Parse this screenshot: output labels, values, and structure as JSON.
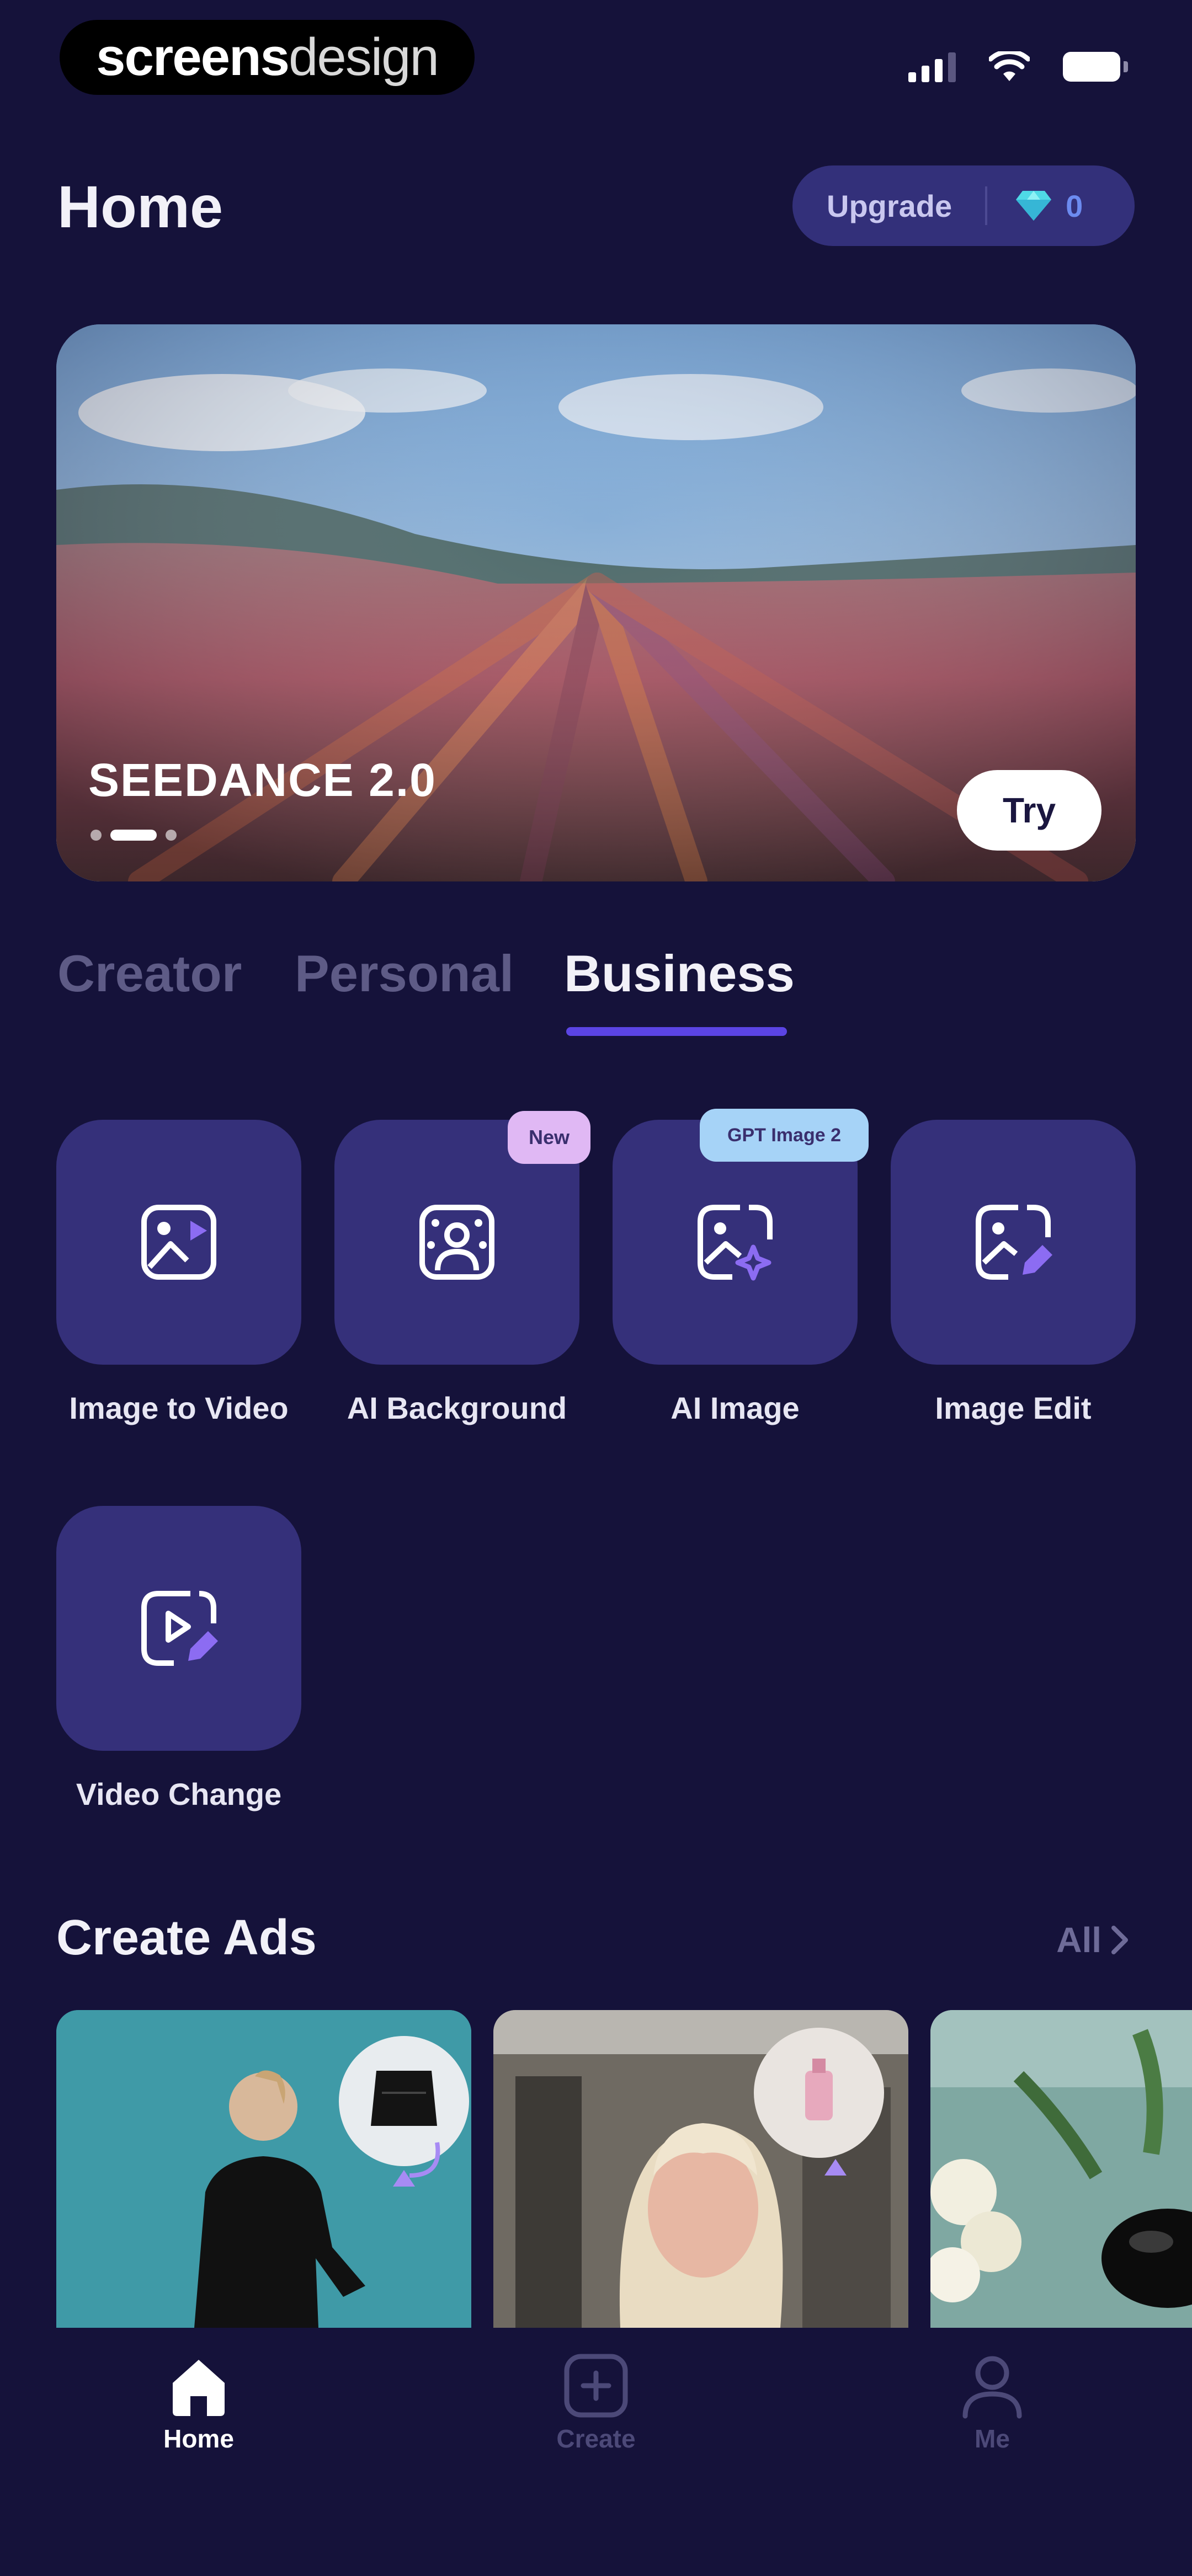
{
  "status_bar": {
    "brand_part1": "screens",
    "brand_part2": "design"
  },
  "header": {
    "title": "Home",
    "upgrade_label": "Upgrade",
    "credits": "0",
    "gem_icon": "diamond-icon"
  },
  "banner": {
    "title": "SEEDANCE 2.0",
    "cta_label": "Try",
    "slide_count": 3,
    "active_slide": 2
  },
  "tabs": [
    {
      "label": "Creator",
      "active": false
    },
    {
      "label": "Personal",
      "active": false
    },
    {
      "label": "Business",
      "active": true
    }
  ],
  "tools": [
    {
      "label": "Image to Video",
      "icon": "image-to-video-icon",
      "badge": ""
    },
    {
      "label": "AI Background",
      "icon": "ai-background-icon",
      "badge": "New"
    },
    {
      "label": "AI Image",
      "icon": "ai-image-icon",
      "badge": "GPT Image 2"
    },
    {
      "label": "Image Edit",
      "icon": "image-edit-icon",
      "badge": ""
    },
    {
      "label": "Video Change",
      "icon": "video-change-icon",
      "badge": ""
    }
  ],
  "create_ads": {
    "title": "Create Ads",
    "see_all_label": "All"
  },
  "bottom_nav": [
    {
      "label": "Home",
      "icon": "home-icon",
      "active": true
    },
    {
      "label": "Create",
      "icon": "create-icon",
      "active": false
    },
    {
      "label": "Me",
      "icon": "profile-icon",
      "active": false
    }
  ],
  "colors": {
    "background": "#15123a",
    "tile": "#35307a",
    "accent": "#5b44e4",
    "inactive_tab": "#5e5b86"
  }
}
